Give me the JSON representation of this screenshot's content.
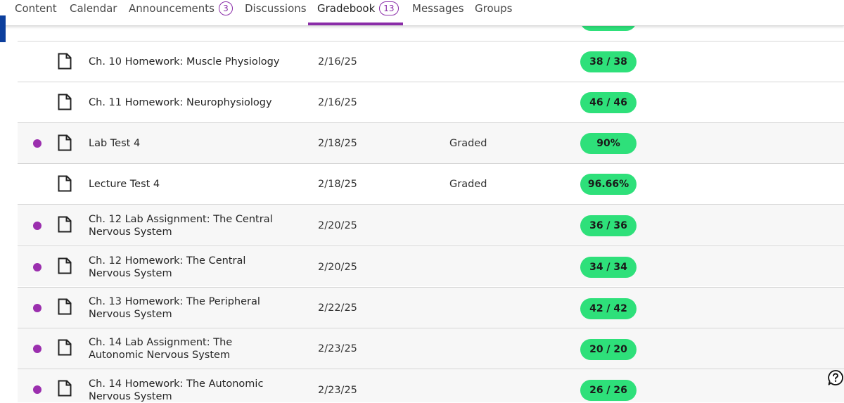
{
  "nav": {
    "tabs": [
      {
        "label": "Content"
      },
      {
        "label": "Calendar"
      },
      {
        "label": "Announcements",
        "badge": "3"
      },
      {
        "label": "Discussions"
      },
      {
        "label": "Gradebook",
        "badge": "13",
        "active": true
      },
      {
        "label": "Messages"
      },
      {
        "label": "Groups"
      }
    ]
  },
  "colors": {
    "accent": "#8a2ca8",
    "score_pill": "#2ee07a",
    "new_dot": "#9b2fae"
  },
  "gradebook": {
    "rows": [
      {
        "title": "Ch. 10 Homework: Muscle Physiology",
        "due": "2/16/25",
        "status": "",
        "score": "38 / 38",
        "new": false
      },
      {
        "title": "Ch. 11 Homework: Neurophysiology",
        "due": "2/16/25",
        "status": "",
        "score": "46 / 46",
        "new": false
      },
      {
        "title": "Lab Test 4",
        "due": "2/18/25",
        "status": "Graded",
        "score": "90%",
        "new": true
      },
      {
        "title": "Lecture Test 4",
        "due": "2/18/25",
        "status": "Graded",
        "score": "96.66%",
        "new": false
      },
      {
        "title": "Ch. 12 Lab Assignment: The Central Nervous System",
        "due": "2/20/25",
        "status": "",
        "score": "36 / 36",
        "new": true
      },
      {
        "title": "Ch. 12 Homework: The Central Nervous System",
        "due": "2/20/25",
        "status": "",
        "score": "34 / 34",
        "new": true
      },
      {
        "title": "Ch. 13 Homework: The Peripheral Nervous System",
        "due": "2/22/25",
        "status": "",
        "score": "42 / 42",
        "new": true
      },
      {
        "title": "Ch. 14 Lab Assignment: The Autonomic Nervous System",
        "due": "2/23/25",
        "status": "",
        "score": "20 / 20",
        "new": true
      },
      {
        "title": "Ch. 14 Homework: The Autonomic Nervous System",
        "due": "2/23/25",
        "status": "",
        "score": "26 / 26",
        "new": true
      }
    ]
  },
  "icons": {
    "item": "document-icon",
    "help": "help-icon"
  }
}
